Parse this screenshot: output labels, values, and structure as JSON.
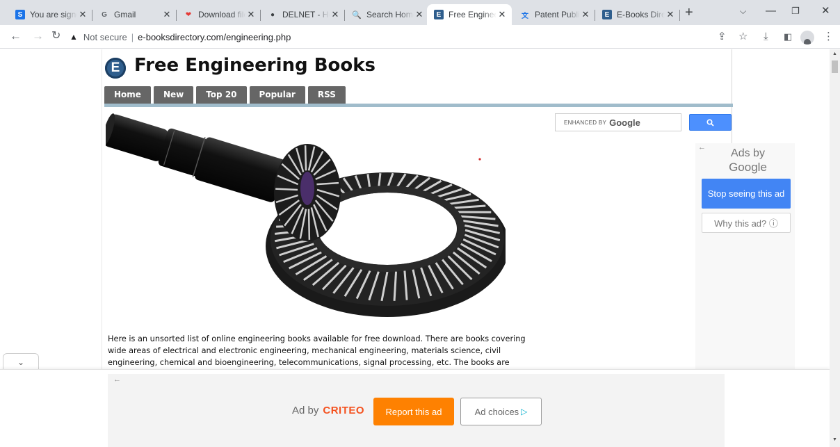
{
  "tabs": [
    {
      "title": "You are signed in",
      "favicon": "S",
      "favicon_color": "#1a73e8"
    },
    {
      "title": "Gmail",
      "favicon": "G",
      "favicon_color": "#5f6368"
    },
    {
      "title": "Download files",
      "favicon": "❤",
      "favicon_color": "#e53935"
    },
    {
      "title": "DELNET - Home",
      "favicon": "●",
      "favicon_color": "#3c4043"
    },
    {
      "title": "Search Home",
      "favicon": "🔍",
      "favicon_color": "#0f9d58"
    },
    {
      "title": "Free Engineering Books",
      "favicon": "E",
      "favicon_color": "#2f5e8d",
      "active": true
    },
    {
      "title": "Patent Public Search",
      "favicon": "文",
      "favicon_color": "#1a73e8"
    },
    {
      "title": "E-Books Directory",
      "favicon": "E",
      "favicon_color": "#2f5e8d"
    }
  ],
  "address": {
    "security": "Not secure",
    "url": "e-booksdirectory.com/engineering.php"
  },
  "site": {
    "logo_letter": "E",
    "title": "Free Engineering Books",
    "nav": [
      "Home",
      "New",
      "Top 20",
      "Popular",
      "RSS"
    ]
  },
  "intro_text": "Here is an unsorted list of online engineering books available for free download. There are books covering wide areas of electrical and electronic engineering, mechanical engineering, materials science, civil engineering, chemical and bioengineering, telecommunications, signal processing, etc. The books are",
  "search": {
    "prefix": "ENHANCED BY",
    "brand": "Google",
    "button_icon": "search-icon"
  },
  "side_ad": {
    "ads_by": "Ads by",
    "brand": "Google",
    "stop_label": "Stop seeing this ad",
    "why_label": "Why this ad? ⓘ"
  },
  "bottom_ad": {
    "ad_by": "Ad by",
    "brand": "CRITEO",
    "report_label": "Report this ad",
    "choices_label": "Ad choices"
  },
  "colors": {
    "nav_tab": "#666666",
    "blue_line": "#a0bccb",
    "google_blue": "#4285f4",
    "criteo_orange": "#fe8101"
  }
}
